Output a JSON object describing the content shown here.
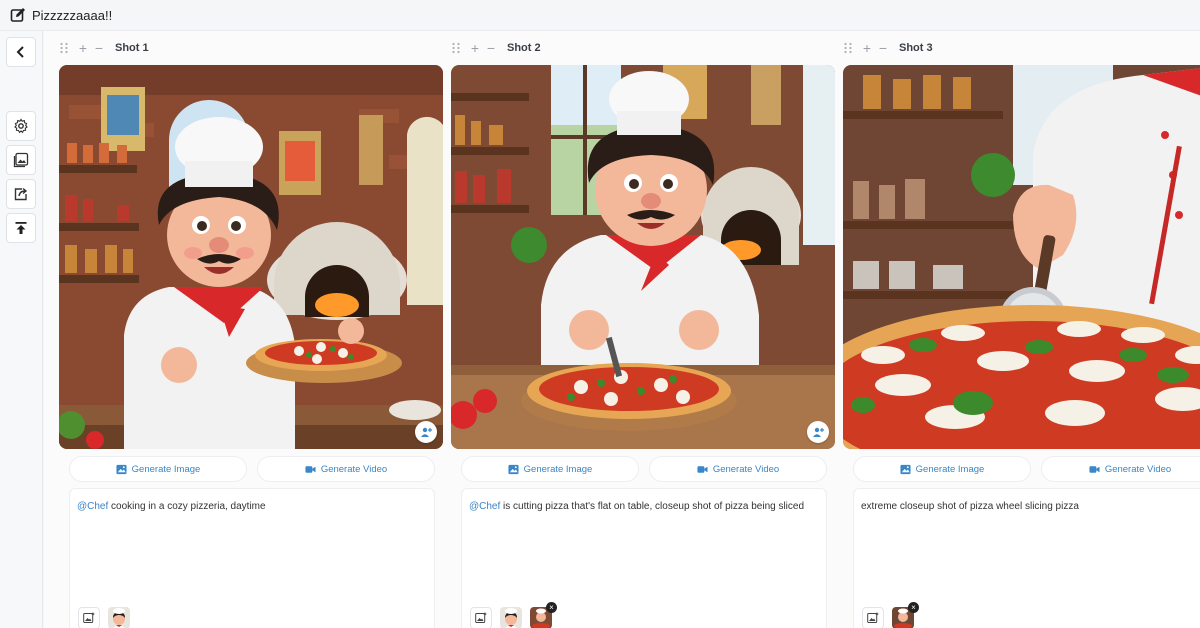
{
  "project": {
    "title": "Pizzzzzaaaa!!"
  },
  "sidebar": {
    "back": "chevron-left-icon",
    "tools": [
      "gear-icon",
      "gallery-icon",
      "share-icon",
      "upload-icon"
    ]
  },
  "shots": [
    {
      "label": "Shot 1",
      "generate_image": "Generate Image",
      "generate_video": "Generate Video",
      "mention": "@Chef",
      "prompt": " cooking in a cozy pizzeria, daytime",
      "has_char_badge": true
    },
    {
      "label": "Shot 2",
      "generate_image": "Generate Image",
      "generate_video": "Generate Video",
      "mention": "@Chef",
      "prompt": " is cutting pizza that's flat on table, closeup shot of pizza being sliced",
      "has_char_badge": true
    },
    {
      "label": "Shot 3",
      "generate_image": "Generate Image",
      "generate_video": "Generate Video",
      "mention": "",
      "prompt": "extreme closeup shot of pizza wheel slicing pizza",
      "has_char_badge": false
    }
  ],
  "colors": {
    "accent": "#3a86c8",
    "background": "#f5f6f8"
  }
}
